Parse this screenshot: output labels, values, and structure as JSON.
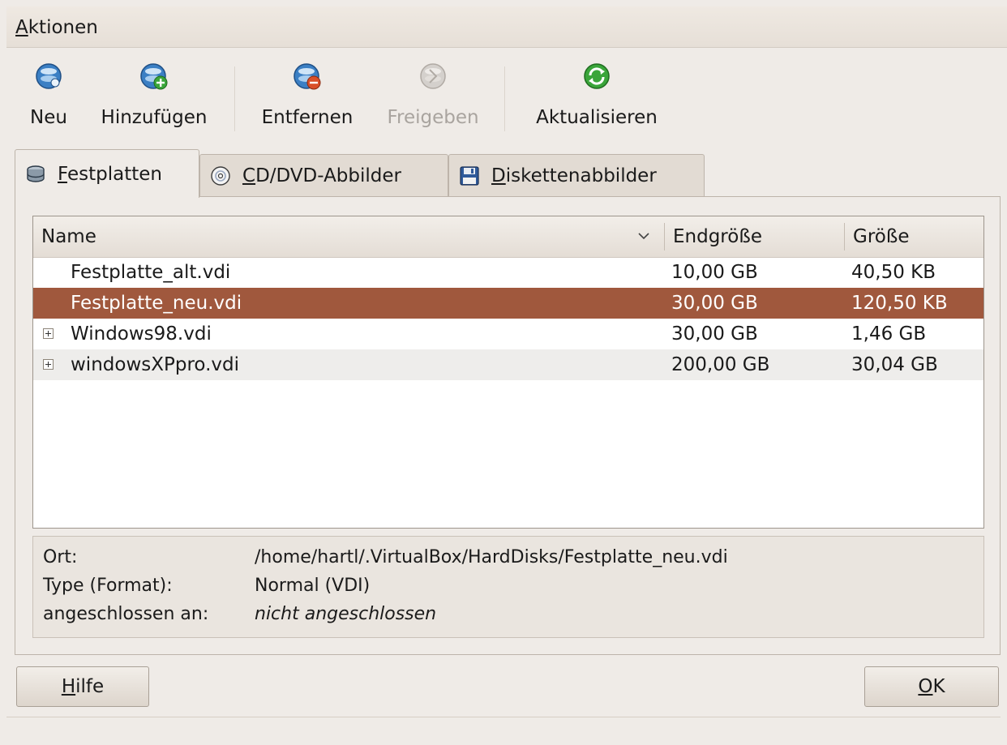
{
  "menubar": {
    "actions_label": "Aktionen"
  },
  "toolbar": {
    "new_label": "Neu",
    "add_label": "Hinzufügen",
    "remove_label": "Entfernen",
    "release_label": "Freigeben",
    "refresh_label": "Aktualisieren"
  },
  "tabs": [
    {
      "label": "Festplatten",
      "icon": "harddisk-icon",
      "active": true
    },
    {
      "label": "CD/DVD-Abbilder",
      "icon": "cd-dvd-icon",
      "active": false
    },
    {
      "label": "Diskettenabbilder",
      "icon": "floppy-icon",
      "active": false
    }
  ],
  "table": {
    "columns": [
      "Name",
      "Endgröße",
      "Größe"
    ],
    "rows": [
      {
        "name": "Festplatte_alt.vdi",
        "endsize": "10,00 GB",
        "size": "40,50 KB",
        "expandable": false,
        "selected": false
      },
      {
        "name": "Festplatte_neu.vdi",
        "endsize": "30,00 GB",
        "size": "120,50 KB",
        "expandable": false,
        "selected": true
      },
      {
        "name": "Windows98.vdi",
        "endsize": "30,00 GB",
        "size": "1,46 GB",
        "expandable": true,
        "selected": false
      },
      {
        "name": "windowsXPpro.vdi",
        "endsize": "200,00 GB",
        "size": "30,04 GB",
        "expandable": true,
        "selected": false
      }
    ]
  },
  "info": {
    "location_label": "Ort:",
    "location_value": "/home/hartl/.VirtualBox/HardDisks/Festplatte_neu.vdi",
    "type_label": "Type (Format):",
    "type_value": "Normal (VDI)",
    "attached_label": "angeschlossen an:",
    "attached_value": "nicht angeschlossen"
  },
  "buttons": {
    "help_label": "Hilfe",
    "ok_label": "OK"
  },
  "colors": {
    "selection": "#a0583d",
    "window_bg": "#efebe7",
    "icon_blue": "#3b7fc4",
    "icon_green": "#3aa53a",
    "icon_red": "#d9502a"
  }
}
